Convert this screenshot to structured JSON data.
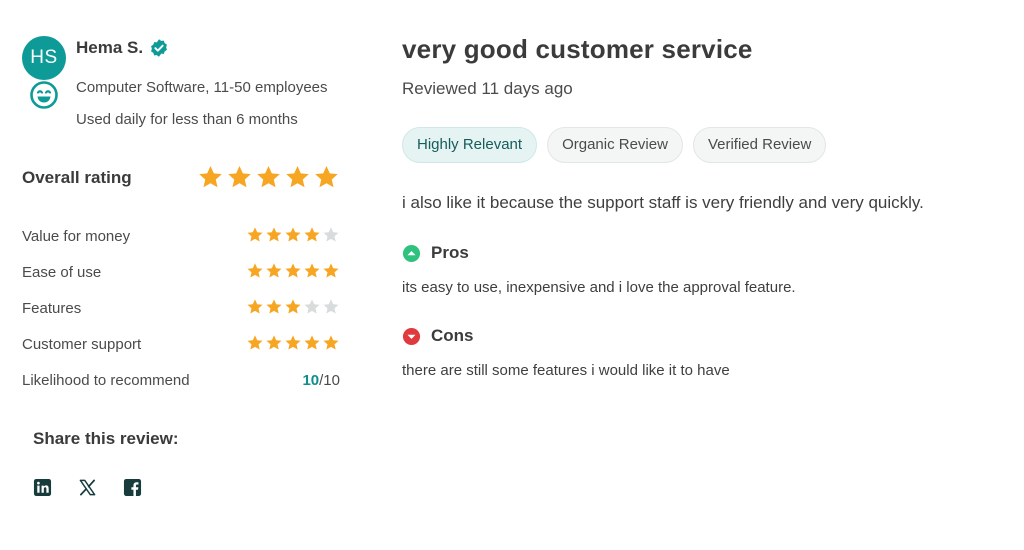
{
  "reviewer": {
    "initials": "HS",
    "name": "Hema S.",
    "company": "Computer Software, 11-50 employees",
    "usage": "Used daily for less than 6 months",
    "avatar_color": "#0e9b98"
  },
  "overall_rating": {
    "label": "Overall rating",
    "stars": 5
  },
  "sub_ratings": [
    {
      "label": "Value for money",
      "stars": 4
    },
    {
      "label": "Ease of use",
      "stars": 5
    },
    {
      "label": "Features",
      "stars": 3
    },
    {
      "label": "Customer support",
      "stars": 5
    }
  ],
  "recommend": {
    "label": "Likelihood to recommend",
    "score": "10",
    "out_of": "/10"
  },
  "share": {
    "title": "Share this review:",
    "icons": [
      "linkedin-icon",
      "x-icon",
      "facebook-icon"
    ]
  },
  "review": {
    "title": "very good customer service",
    "date": "Reviewed 11 days ago",
    "tags": [
      "Highly Relevant",
      "Organic Review",
      "Verified Review"
    ],
    "body": "i also like it because the support staff is very friendly and very quickly.",
    "pros_label": "Pros",
    "pros_text": "its easy to use, inexpensive and i love the approval feature.",
    "cons_label": "Cons",
    "cons_text": "there are still some features i would like it to have"
  },
  "colors": {
    "brand": "#0e9b98",
    "star": "#f6a623",
    "star_empty": "#d9dcdc",
    "pros": "#2ec27e",
    "cons": "#e0393e"
  }
}
